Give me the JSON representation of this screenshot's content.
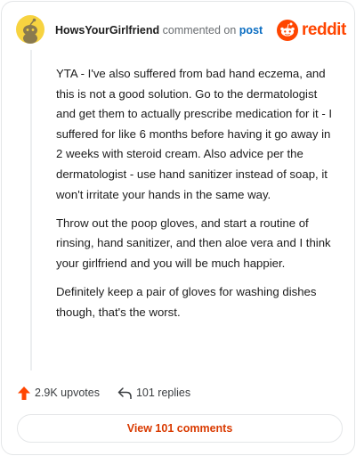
{
  "comment": {
    "username": "HowsYourGirlfriend",
    "commented_on": "commented on",
    "post_link": "post",
    "paragraphs": [
      "YTA - I've also suffered from bad hand eczema, and this is not a good solution. Go to the dermatologist and get them to actually prescribe medication for it - I suffered for like 6 months before having it go away in 2 weeks with steroid cream. Also advice per the dermatologist - use hand sanitizer instead of soap, it won't irritate your hands in the same way.",
      "Throw out the poop gloves, and start a routine of rinsing, hand sanitizer, and then aloe vera and I think your girlfriend and you will be much happier.",
      "Definitely keep a pair of gloves for washing dishes though, that's the worst."
    ],
    "upvotes": "2.9K upvotes",
    "replies": "101 replies",
    "view_comments": "View 101 comments"
  },
  "brand": {
    "logo_text": "reddit"
  },
  "icons": {
    "avatar": "snoo-avatar-icon",
    "logo": "reddit-snoo-icon",
    "upvote": "upvote-arrow-icon",
    "reply": "reply-arrow-icon"
  },
  "colors": {
    "brand_orange": "#ff4500",
    "link_blue": "#0a6dc2",
    "button_text": "#d93a00",
    "avatar_bg": "#f7d340",
    "upvote": "#ff4500"
  }
}
